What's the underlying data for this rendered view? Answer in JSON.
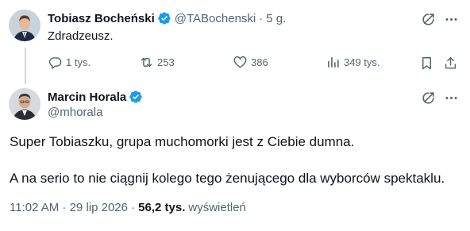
{
  "tweet1": {
    "author_name": "Tobiasz Bocheński",
    "handle": "@TABochenski",
    "separator": "·",
    "time": "5 g.",
    "text": "Zdradzeusz.",
    "replies": "1 tys.",
    "retweets": "253",
    "likes": "386",
    "views": "349 tys.",
    "icons": [
      "grok-icon",
      "more-icon",
      "reply-icon",
      "retweet-icon",
      "like-icon",
      "views-icon",
      "bookmark-icon",
      "share-icon"
    ]
  },
  "tweet2": {
    "author_name": "Marcin Horala",
    "handle": "@mhorala",
    "line1": "Super Tobiaszku, grupa muchomorki jest z Ciebie dumna.",
    "line2": "A na serio to nie ciągnij kolego tego żenującego dla wyborców spektaklu.",
    "timestamp": "11:02 AM · 29 lip 2026 ·",
    "views_count": "56,2 tys.",
    "views_label": "wyświetleń"
  },
  "colors": {
    "verified": "#1d9bf0",
    "secondary_text": "#536471",
    "primary_text": "#0f1419",
    "thread_line": "#cfd9de"
  }
}
